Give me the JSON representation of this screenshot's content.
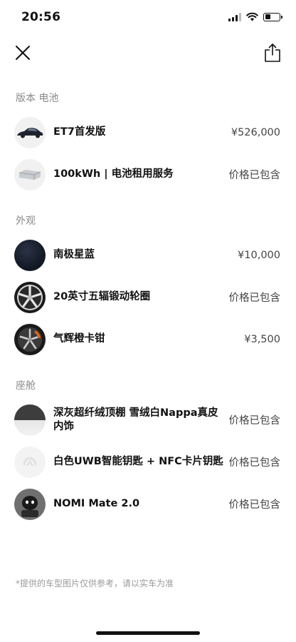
{
  "status": {
    "time": "20:56"
  },
  "sections": [
    {
      "title": "版本 电池",
      "items": [
        {
          "label": "ET7首发版",
          "price": "¥526,000",
          "icon": "car-thumbnail"
        },
        {
          "label": "100kWh | 电池租用服务",
          "price": "价格已包含",
          "icon": "battery-pack-thumbnail"
        }
      ]
    },
    {
      "title": "外观",
      "items": [
        {
          "label": "南极星蓝",
          "price": "¥10,000",
          "icon": "paint-color-swatch"
        },
        {
          "label": "20英寸五辐锻动轮圈",
          "price": "价格已包含",
          "icon": "wheel-thumbnail"
        },
        {
          "label": "气辉橙卡钳",
          "price": "¥3,500",
          "icon": "caliper-thumbnail"
        }
      ]
    },
    {
      "title": "座舱",
      "items": [
        {
          "label": "深灰超纤绒顶棚 雪绒白Nappa真皮内饰",
          "price": "价格已包含",
          "icon": "interior-swatch"
        },
        {
          "label": "白色UWB智能钥匙 + NFC卡片钥匙",
          "price": "价格已包含",
          "icon": "key-thumbnail"
        },
        {
          "label": "NOMI Mate 2.0",
          "price": "价格已包含",
          "icon": "nomi-thumbnail"
        }
      ]
    }
  ],
  "footnote": "*提供的车型图片仅供参考，请以实车为准"
}
